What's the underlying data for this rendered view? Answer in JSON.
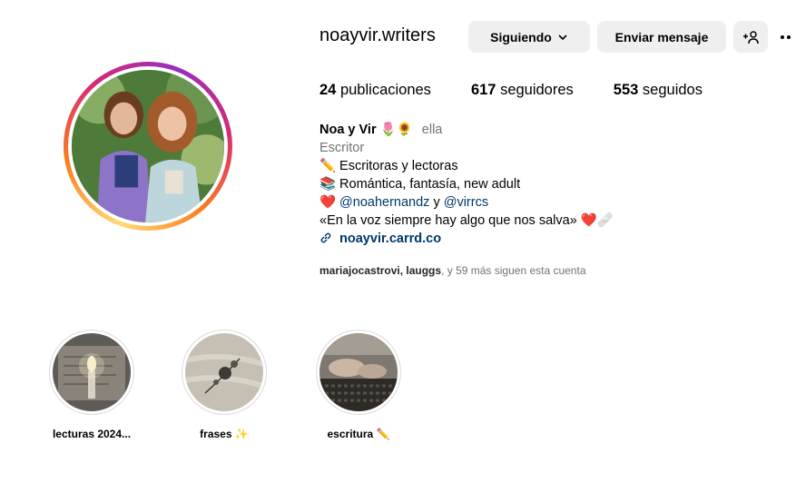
{
  "profile": {
    "username": "noayvir.writers",
    "following_button": "Siguiendo",
    "message_button": "Enviar mensaje"
  },
  "stats": {
    "posts_count": "24",
    "posts_label": "publicaciones",
    "followers_count": "617",
    "followers_label": "seguidores",
    "following_count": "553",
    "following_label": "seguidos"
  },
  "bio": {
    "name": "Noa y Vir",
    "name_emojis": "🌷🌻",
    "pronouns": "ella",
    "category": "Escritor",
    "line1_emoji": "✏️",
    "line1_text": "Escritoras y lectoras",
    "line2_emoji": "📚",
    "line2_text": "Romántica, fantasía, new adult",
    "line3_emoji": "❤️",
    "mention1": "@noahernandz",
    "connector": "y",
    "mention2": "@virrcs",
    "quote": "«En la voz siempre hay algo que nos salva»",
    "quote_emojis": "❤️🩹",
    "link": "noayvir.carrd.co"
  },
  "followed_by": {
    "names": "mariajocastrovi, lauggs",
    "rest": ", y 59 más siguen esta cuenta"
  },
  "highlights": [
    {
      "label": "lecturas 2024..."
    },
    {
      "label": "frases ✨"
    },
    {
      "label": "escritura ✏️"
    }
  ],
  "colors": {
    "button_bg": "#efefef",
    "secondary_text": "#737373",
    "link": "#00376b"
  }
}
